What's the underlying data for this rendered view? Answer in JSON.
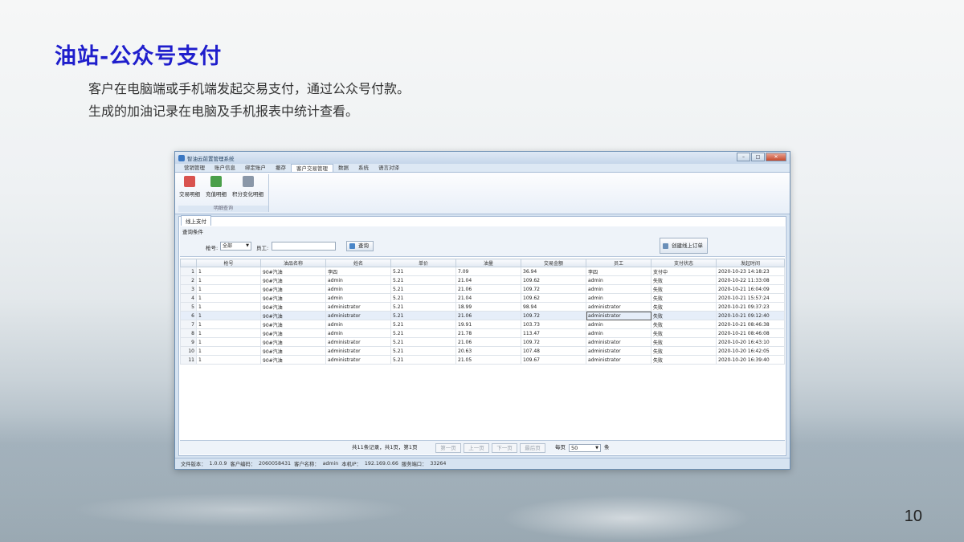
{
  "slide": {
    "title": "油站-公众号支付",
    "lines": [
      "客户在电脑端或手机端发起交易支付，通过公众号付款。",
      "生成的加油记录在电脑及手机报表中统计查看。"
    ],
    "page_number": "10"
  },
  "window": {
    "title": "智油云前置管理系统",
    "controls": {
      "minimize": "–",
      "maximize": "□",
      "close": "✕"
    },
    "menu_tabs": [
      "营销管理",
      "账户信息",
      "绑定账户",
      "撤存",
      "客户交易管理",
      "数据",
      "系统",
      "语言对译"
    ],
    "active_tab": "客户交易管理",
    "ribbon": {
      "buttons": [
        {
          "label": "交易明细",
          "icon": "transaction-detail-icon",
          "color": "#d9534f"
        },
        {
          "label": "充值明细",
          "icon": "recharge-detail-icon",
          "color": "#4a9f4a"
        },
        {
          "label": "积分变化明细",
          "icon": "points-detail-icon",
          "color": "#8a97a8"
        }
      ],
      "group_label": "明细查询"
    },
    "doc_tab": "线上支付",
    "query": {
      "title": "查询条件",
      "gun_label": "枪号:",
      "gun_value": "全部",
      "staff_label": "员工:",
      "staff_value": "",
      "search_label": "查询",
      "create_order_label": "创建线上订单"
    },
    "grid": {
      "columns": [
        "枪号",
        "油品名称",
        "姓名",
        "单价",
        "油量",
        "交易金额",
        "员工",
        "支付状态",
        "发起时间"
      ],
      "rows": [
        {
          "no": "1",
          "gun": "1",
          "oil": "90#汽油",
          "name": "李四",
          "price": "5.21",
          "volume": "7.09",
          "amount": "36.94",
          "staff": "李四",
          "status": "支付中",
          "time": "2020-10-23 14:18:23"
        },
        {
          "no": "2",
          "gun": "1",
          "oil": "90#汽油",
          "name": "admin",
          "price": "5.21",
          "volume": "21.04",
          "amount": "109.62",
          "staff": "admin",
          "status": "失败",
          "time": "2020-10-22 11:33:08"
        },
        {
          "no": "3",
          "gun": "1",
          "oil": "90#汽油",
          "name": "admin",
          "price": "5.21",
          "volume": "21.06",
          "amount": "109.72",
          "staff": "admin",
          "status": "失败",
          "time": "2020-10-21 16:04:09"
        },
        {
          "no": "4",
          "gun": "1",
          "oil": "90#汽油",
          "name": "admin",
          "price": "5.21",
          "volume": "21.04",
          "amount": "109.62",
          "staff": "admin",
          "status": "失败",
          "time": "2020-10-21 15:57:24"
        },
        {
          "no": "5",
          "gun": "1",
          "oil": "90#汽油",
          "name": "administrator",
          "price": "5.21",
          "volume": "18.99",
          "amount": "98.94",
          "staff": "administrator",
          "status": "失败",
          "time": "2020-10-21 09:37:23"
        },
        {
          "no": "6",
          "gun": "1",
          "oil": "90#汽油",
          "name": "administrator",
          "price": "5.21",
          "volume": "21.06",
          "amount": "109.72",
          "staff": "administrator",
          "status": "失败",
          "time": "2020-10-21 09:12:40"
        },
        {
          "no": "7",
          "gun": "1",
          "oil": "90#汽油",
          "name": "admin",
          "price": "5.21",
          "volume": "19.91",
          "amount": "103.73",
          "staff": "admin",
          "status": "失败",
          "time": "2020-10-21 08:46:38"
        },
        {
          "no": "8",
          "gun": "1",
          "oil": "90#汽油",
          "name": "admin",
          "price": "5.21",
          "volume": "21.78",
          "amount": "113.47",
          "staff": "admin",
          "status": "失败",
          "time": "2020-10-21 08:46:08"
        },
        {
          "no": "9",
          "gun": "1",
          "oil": "90#汽油",
          "name": "administrator",
          "price": "5.21",
          "volume": "21.06",
          "amount": "109.72",
          "staff": "administrator",
          "status": "失败",
          "time": "2020-10-20 16:43:10"
        },
        {
          "no": "10",
          "gun": "1",
          "oil": "90#汽油",
          "name": "administrator",
          "price": "5.21",
          "volume": "20.63",
          "amount": "107.48",
          "staff": "administrator",
          "status": "失败",
          "time": "2020-10-20 16:42:05"
        },
        {
          "no": "11",
          "gun": "1",
          "oil": "90#汽油",
          "name": "administrator",
          "price": "5.21",
          "volume": "21.05",
          "amount": "109.67",
          "staff": "administrator",
          "status": "失败",
          "time": "2020-10-20 16:39:40"
        }
      ],
      "selected_row": 6
    },
    "pager": {
      "summary": "共11条记录，共1页，第1页",
      "first": "第一页",
      "prev": "上一页",
      "next": "下一页",
      "last": "最后页",
      "per_page_label": "每页",
      "per_page_value": "50",
      "unit": "条"
    },
    "status_bar": {
      "version_label": "文件版本：",
      "version": "1.0.0.9",
      "customer_id_label": "客户编码：",
      "customer_id": "2060058431",
      "customer_name_label": "客户名称：",
      "customer_name": "admin",
      "ip_label": "本机IP：",
      "ip": "192.169.0.66",
      "port_label": "服务端口：",
      "port": "33264"
    }
  }
}
